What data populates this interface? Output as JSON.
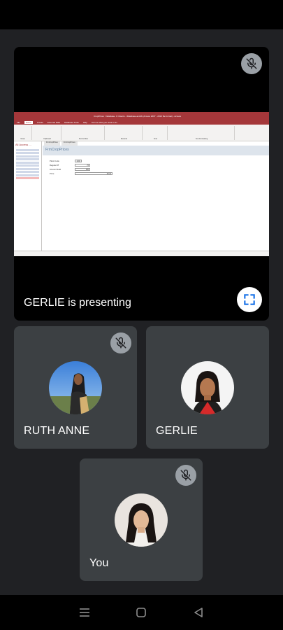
{
  "presentation": {
    "presenter_label": "GERLIE is presenting",
    "shared_screen": {
      "window_title": "CropPrices : Database- C:\\Users\\...\\Database.accdb (Access 2007 - 2016 file format) - Access",
      "tabs": [
        "File",
        "Home",
        "Create",
        "External Data",
        "Database Tools",
        "Help",
        "Tell me what you want to do"
      ],
      "ribbon_groups": [
        "Views",
        "Clipboard",
        "Sort & Filter",
        "Records",
        "Find",
        "Text Formatting"
      ],
      "nav_header": "All Access ...",
      "form_tabs": [
        "FrmCropPrices",
        "FrmCropPrices"
      ],
      "form_title": "FrmCropPrices",
      "fields": [
        {
          "label": "Plant Code",
          "value": "1000"
        },
        {
          "label": "Regular Pf",
          "value": "76"
        },
        {
          "label": "Amount Sold",
          "value": "250"
        },
        {
          "label": "Price",
          "value": "48.20"
        }
      ]
    }
  },
  "participants": [
    {
      "name": "RUTH ANNE",
      "muted": true
    },
    {
      "name": "GERLIE",
      "muted": false
    },
    {
      "name": "You",
      "muted": true
    }
  ],
  "icons": {
    "mute": "mic-off-icon",
    "fullscreen": "fullscreen-icon",
    "nav_recent": "recent-apps-icon",
    "nav_home": "home-icon",
    "nav_back": "back-icon"
  }
}
